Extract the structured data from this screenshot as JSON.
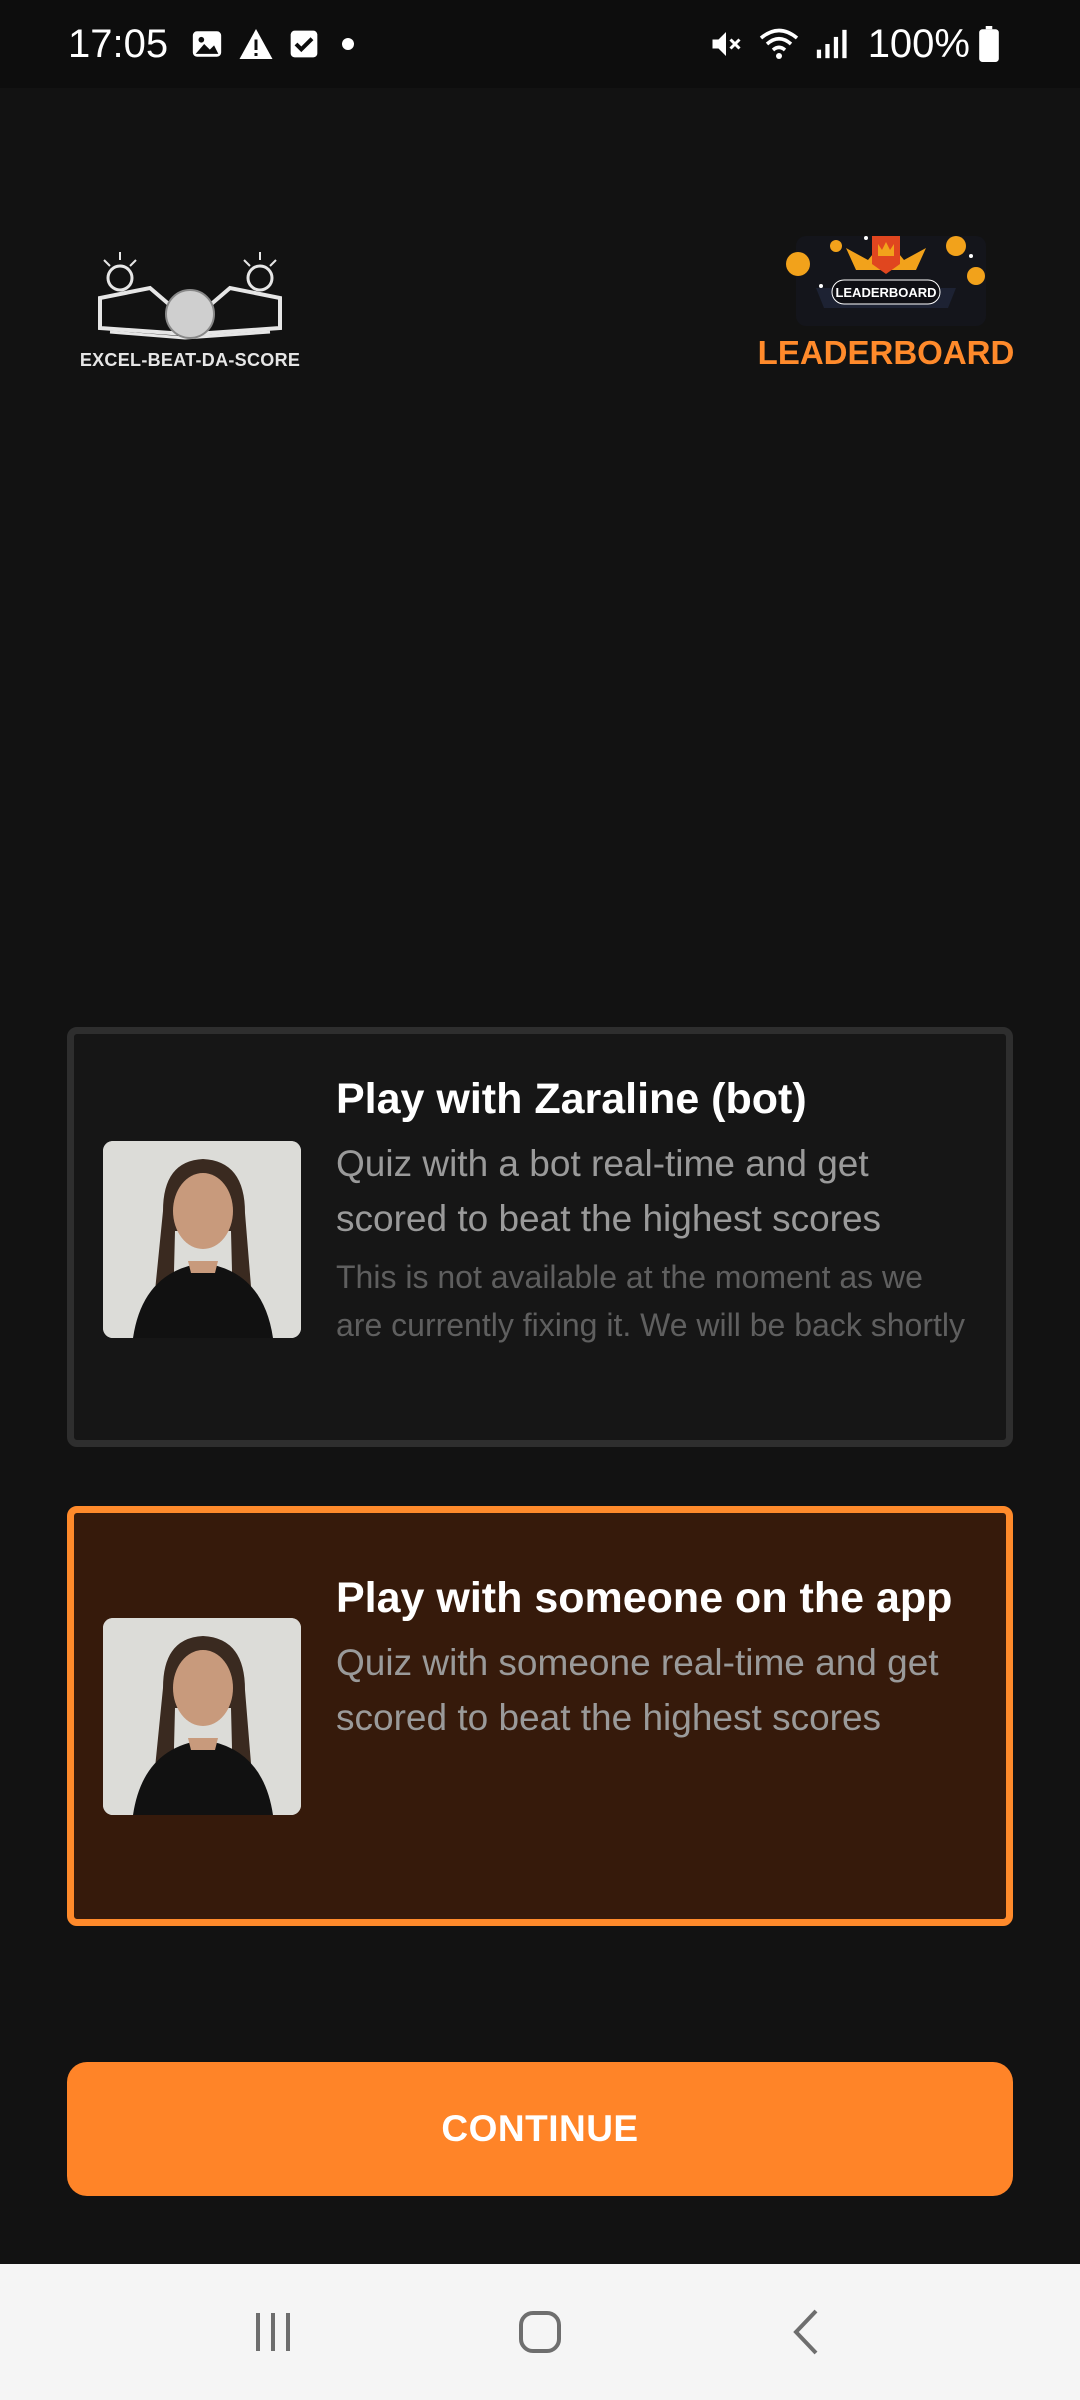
{
  "status_bar": {
    "time": "17:05",
    "battery_text": "100%",
    "left_icons": [
      "gallery-icon",
      "warning-icon",
      "checkbox-icon",
      "dot-icon"
    ],
    "right_icons": [
      "mute-icon",
      "wifi-icon",
      "signal-icon",
      "battery-icon"
    ]
  },
  "header": {
    "brand_name": "EXCEL-BEAT-DA-SCORE",
    "leaderboard_badge": "LEADERBOARD",
    "leaderboard_label": "LEADERBOARD"
  },
  "options": [
    {
      "title": "Play with Zaraline (bot)",
      "description": "Quiz with a bot real-time and get scored to beat the highest scores",
      "note": "This is not available at the moment as we are currently fixing it. We will be back shortly",
      "selected": false
    },
    {
      "title": "Play with someone on the app",
      "description": "Quiz with someone real-time and get scored to beat the highest scores",
      "selected": true
    }
  ],
  "continue_label": "CONTINUE",
  "colors": {
    "accent": "#ff8428",
    "background": "#121212",
    "selected_card_bg": "#361a0b",
    "card_border": "#2e2e2e"
  }
}
